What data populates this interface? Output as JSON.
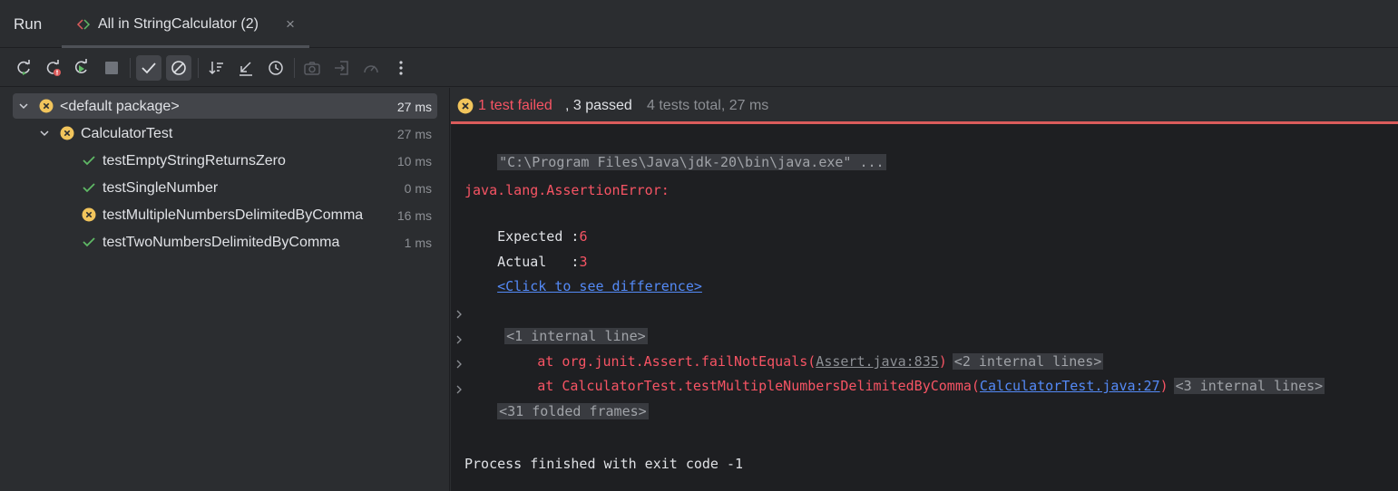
{
  "header": {
    "run_label": "Run",
    "tab_title": "All in StringCalculator (2)",
    "tab_close": "×"
  },
  "toolbar": {
    "buttons": [
      "rerun-icon",
      "rerun-failed-icon",
      "toggle-auto-test-icon",
      "stop-icon",
      "show-passed-icon",
      "show-ignored-icon",
      "sort-icon",
      "collapse-icon",
      "history-icon",
      "screenshot-icon",
      "import-icon",
      "coverage-icon",
      "more-icon"
    ]
  },
  "tree": {
    "items": [
      {
        "name": "<default package>",
        "duration": "27 ms",
        "status": "failed"
      },
      {
        "name": "CalculatorTest",
        "duration": "27 ms",
        "status": "failed"
      },
      {
        "name": "testEmptyStringReturnsZero",
        "duration": "10 ms",
        "status": "passed"
      },
      {
        "name": "testSingleNumber",
        "duration": "0 ms",
        "status": "passed"
      },
      {
        "name": "testMultipleNumbersDelimitedByComma",
        "duration": "16 ms",
        "status": "failed"
      },
      {
        "name": "testTwoNumbersDelimitedByComma",
        "duration": "1 ms",
        "status": "passed"
      }
    ]
  },
  "summary": {
    "failed": "1 test failed",
    "passed": ", 3 passed",
    "total": "4 tests total, 27 ms"
  },
  "console": {
    "command": "\"C:\\Program Files\\Java\\jdk-20\\bin\\java.exe\" ...",
    "error": "java.lang.AssertionError:",
    "expected_label": "Expected :",
    "expected_value": "6",
    "actual_label": "Actual   :",
    "actual_value": "3",
    "diff_link": "<Click to see difference>",
    "internal1": "<1 internal line>",
    "stack1_prefix": "    at org.junit.Assert.failNotEquals(",
    "stack1_link": "Assert.java:835",
    "stack1_suffix": ")",
    "internal2": "<2 internal lines>",
    "stack2_prefix": "    at CalculatorTest.testMultipleNumbersDelimitedByComma(",
    "stack2_link": "CalculatorTest.java:27",
    "stack2_suffix": ")",
    "internal3": "<3 internal lines>",
    "folded_frames": "<31 folded frames>",
    "exit": "Process finished with exit code -1"
  },
  "colors": {
    "error": "#f75464",
    "link": "#548af7",
    "passed": "#5fb865",
    "warning": "#f2c55c"
  }
}
